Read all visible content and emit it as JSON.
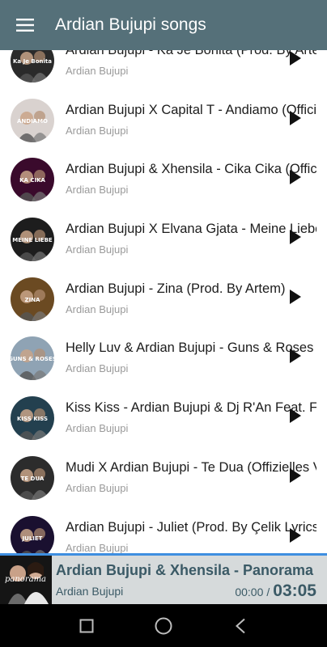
{
  "appbar": {
    "title": "Ardian Bujupi songs",
    "menu_icon": "hamburger-menu-icon",
    "color": "#557079"
  },
  "songs": [
    {
      "title": "Ardian Bujupi - Ka Je Bonita (Prod. By Artem)",
      "artist": "Ardian Bujupi",
      "thumb_color": "#2a2a2a",
      "thumb_text": "Ka Je Bonita"
    },
    {
      "title": "Ardian Bujupi X Capital T - Andiamo (Official Video)",
      "artist": "Ardian Bujupi",
      "thumb_color": "#d9d2cf",
      "thumb_text": "ANDIAMO"
    },
    {
      "title": "Ardian Bujupi & Xhensila - Cika Cika (Official Video)",
      "artist": "Ardian Bujupi",
      "thumb_color": "#3a0a2c",
      "thumb_text": "KA CIKA"
    },
    {
      "title": "Ardian Bujupi X Elvana Gjata - Meine Liebe",
      "artist": "Ardian Bujupi",
      "thumb_color": "#1d1d1d",
      "thumb_text": "MEINE LIEBE"
    },
    {
      "title": "Ardian Bujupi - Zina (Prod. By Artem)",
      "artist": "Ardian Bujupi",
      "thumb_color": "#6b4a22",
      "thumb_text": "ZINA"
    },
    {
      "title": "Helly Luv & Ardian Bujupi - Guns & Roses (Official Video)",
      "artist": "Ardian Bujupi",
      "thumb_color": "#8fa3b4",
      "thumb_text": "GUNS & ROSES"
    },
    {
      "title": "Kiss Kiss - Ardian Bujupi & Dj R'An Feat. Fatima Ezzahra",
      "artist": "Ardian Bujupi",
      "thumb_color": "#23404f",
      "thumb_text": "KISS KISS"
    },
    {
      "title": "Mudi X Ardian Bujupi - Te Dua (Offizielles Video)",
      "artist": "Ardian Bujupi",
      "thumb_color": "#2c2c2c",
      "thumb_text": "TE DUA"
    },
    {
      "title": "Ardian Bujupi - Juliet (Prod. By Çelik Lyrics)",
      "artist": "Ardian Bujupi",
      "thumb_color": "#1a1030",
      "thumb_text": "JULIET"
    }
  ],
  "player": {
    "title": "Ardian Bujupi & Xhensila - Panorama",
    "artist": "Ardian Bujupi",
    "current_time": "00:00",
    "separator": "/",
    "total_time": "03:05",
    "art_text": "panorama",
    "accent": "#3e8ee0",
    "background": "#d6dadb"
  },
  "navbar": {
    "recents_icon": "square-recents-icon",
    "home_icon": "circle-home-icon",
    "back_icon": "triangle-back-icon"
  }
}
